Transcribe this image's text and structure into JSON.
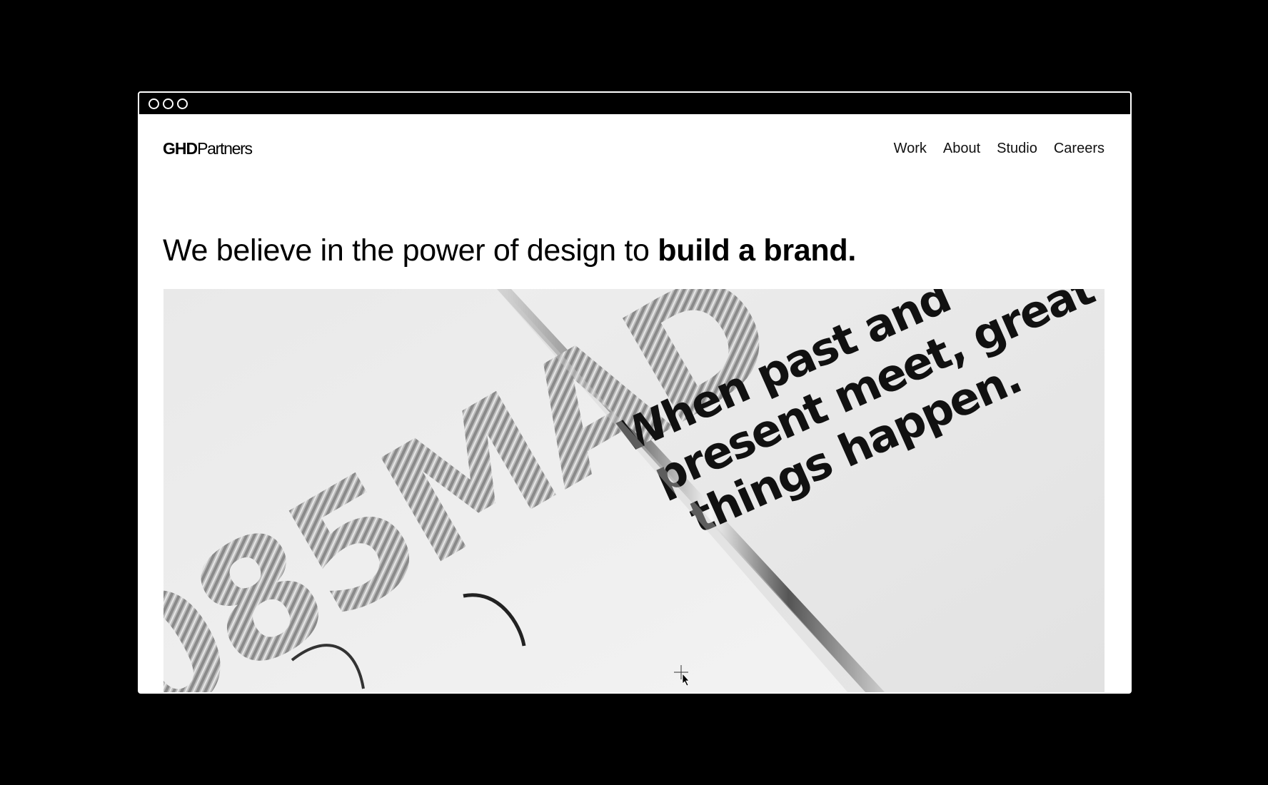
{
  "window": {
    "traffic_lights": [
      "window-control-circle",
      "window-control-circle",
      "window-control-circle"
    ]
  },
  "header": {
    "logo_bold": "GHD",
    "logo_light": "Partners",
    "nav": [
      "Work",
      "About",
      "Studio",
      "Careers"
    ]
  },
  "hero": {
    "headline_regular": "We believe in the power of design to ",
    "headline_bold": "build a brand."
  },
  "image": {
    "poster_line_1": "When past and",
    "poster_line_2": "present meet, great",
    "poster_line_3": "things happen.",
    "large_type": "085MAD"
  },
  "colors": {
    "background": "#000000",
    "page": "#ffffff",
    "text": "#000000",
    "photo_paper": "#ececec"
  }
}
